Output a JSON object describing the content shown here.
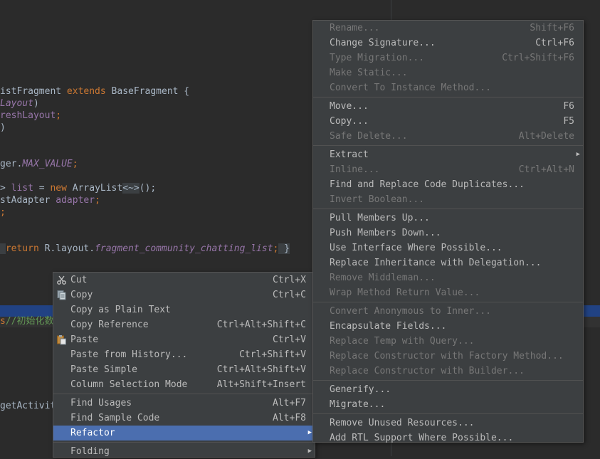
{
  "editor": {
    "lines": [
      {
        "parts": [
          {
            "t": "istFragment ",
            "c": "plain"
          },
          {
            "t": "extends ",
            "c": "kw"
          },
          {
            "t": "BaseFragment {",
            "c": "plain"
          }
        ]
      },
      {
        "parts": [
          {
            "t": "Layout",
            "c": "it"
          },
          {
            "t": ")",
            "c": "plain"
          }
        ]
      },
      {
        "parts": [
          {
            "t": "reshLayout",
            "c": "fld"
          },
          {
            "t": ";",
            "c": "kw"
          }
        ]
      },
      {
        "parts": [
          {
            "t": ")",
            "c": "plain"
          }
        ]
      },
      {
        "parts": [
          {
            "t": "ger.",
            "c": "plain"
          },
          {
            "t": "MAX_VALUE",
            "c": "it"
          },
          {
            "t": ";",
            "c": "kw"
          }
        ]
      },
      {
        "parts": [
          {
            "t": "> ",
            "c": "plain"
          },
          {
            "t": "list",
            "c": "fld"
          },
          {
            "t": " = ",
            "c": "plain"
          },
          {
            "t": "new ",
            "c": "kw"
          },
          {
            "t": "ArrayList",
            "c": "plain"
          },
          {
            "t": "<~>",
            "c": "fold"
          },
          {
            "t": "();",
            "c": "plain"
          }
        ]
      },
      {
        "parts": [
          {
            "t": "stAdapter ",
            "c": "plain"
          },
          {
            "t": "adapter",
            "c": "fld"
          },
          {
            "t": ";",
            "c": "kw"
          }
        ]
      },
      {
        "parts": [
          {
            "t": ";",
            "c": "kw"
          }
        ]
      },
      {
        "parts": [
          {
            "t": " ",
            "c": "fold"
          },
          {
            "t": "return ",
            "c": "kw"
          },
          {
            "t": "R.layout.",
            "c": "plain"
          },
          {
            "t": "fragment_community_chatting_list",
            "c": "it"
          },
          {
            "t": ";",
            "c": "kw"
          },
          {
            "t": " }",
            "c": "fold"
          }
        ]
      },
      {
        "parts": [
          {
            "t": "s",
            "c": "kw"
          },
          {
            "t": "//初始化数",
            "c": "cmt"
          }
        ]
      },
      {
        "parts": [
          {
            "t": "getActivit",
            "c": "plain"
          }
        ]
      }
    ]
  },
  "context_menu": {
    "items": [
      {
        "label": "Cut",
        "shortcut": "Ctrl+X",
        "icon": "scissors-icon",
        "disabled": false
      },
      {
        "label": "Copy",
        "shortcut": "Ctrl+C",
        "icon": "copy-icon",
        "disabled": false
      },
      {
        "label": "Copy as Plain Text",
        "shortcut": "",
        "icon": "",
        "disabled": false
      },
      {
        "label": "Copy Reference",
        "shortcut": "Ctrl+Alt+Shift+C",
        "icon": "",
        "disabled": false
      },
      {
        "label": "Paste",
        "shortcut": "Ctrl+V",
        "icon": "paste-icon",
        "disabled": false
      },
      {
        "label": "Paste from History...",
        "shortcut": "Ctrl+Shift+V",
        "icon": "",
        "disabled": false
      },
      {
        "label": "Paste Simple",
        "shortcut": "Ctrl+Alt+Shift+V",
        "icon": "",
        "disabled": false
      },
      {
        "label": "Column Selection Mode",
        "shortcut": "Alt+Shift+Insert",
        "icon": "",
        "disabled": false
      },
      {
        "sep": true
      },
      {
        "label": "Find Usages",
        "shortcut": "Alt+F7",
        "icon": "",
        "disabled": false
      },
      {
        "label": "Find Sample Code",
        "shortcut": "Alt+F8",
        "icon": "",
        "disabled": false
      },
      {
        "label": "Refactor",
        "shortcut": "",
        "icon": "",
        "disabled": false,
        "submenu": true,
        "highlighted": true
      },
      {
        "sep": true
      },
      {
        "label": "Folding",
        "shortcut": "",
        "icon": "",
        "disabled": false,
        "submenu": true
      }
    ]
  },
  "refactor_menu": {
    "items": [
      {
        "label": "Rename...",
        "shortcut": "Shift+F6",
        "disabled": true
      },
      {
        "label": "Change Signature...",
        "shortcut": "Ctrl+F6",
        "disabled": false
      },
      {
        "label": "Type Migration...",
        "shortcut": "Ctrl+Shift+F6",
        "disabled": true
      },
      {
        "label": "Make Static...",
        "shortcut": "",
        "disabled": true
      },
      {
        "label": "Convert To Instance Method...",
        "shortcut": "",
        "disabled": true
      },
      {
        "sep": true
      },
      {
        "label": "Move...",
        "shortcut": "F6",
        "disabled": false
      },
      {
        "label": "Copy...",
        "shortcut": "F5",
        "disabled": false
      },
      {
        "label": "Safe Delete...",
        "shortcut": "Alt+Delete",
        "disabled": true
      },
      {
        "sep": true
      },
      {
        "label": "Extract",
        "shortcut": "",
        "disabled": false,
        "submenu": true
      },
      {
        "label": "Inline...",
        "shortcut": "Ctrl+Alt+N",
        "disabled": true
      },
      {
        "label": "Find and Replace Code Duplicates...",
        "shortcut": "",
        "disabled": false
      },
      {
        "label": "Invert Boolean...",
        "shortcut": "",
        "disabled": true
      },
      {
        "sep": true
      },
      {
        "label": "Pull Members Up...",
        "shortcut": "",
        "disabled": false
      },
      {
        "label": "Push Members Down...",
        "shortcut": "",
        "disabled": false
      },
      {
        "label": "Use Interface Where Possible...",
        "shortcut": "",
        "disabled": false
      },
      {
        "label": "Replace Inheritance with Delegation...",
        "shortcut": "",
        "disabled": false
      },
      {
        "label": "Remove Middleman...",
        "shortcut": "",
        "disabled": true
      },
      {
        "label": "Wrap Method Return Value...",
        "shortcut": "",
        "disabled": true
      },
      {
        "sep": true
      },
      {
        "label": "Convert Anonymous to Inner...",
        "shortcut": "",
        "disabled": true
      },
      {
        "label": "Encapsulate Fields...",
        "shortcut": "",
        "disabled": false
      },
      {
        "label": "Replace Temp with Query...",
        "shortcut": "",
        "disabled": true
      },
      {
        "label": "Replace Constructor with Factory Method...",
        "shortcut": "",
        "disabled": true
      },
      {
        "label": "Replace Constructor with Builder...",
        "shortcut": "",
        "disabled": true
      },
      {
        "sep": true
      },
      {
        "label": "Generify...",
        "shortcut": "",
        "disabled": false
      },
      {
        "label": "Migrate...",
        "shortcut": "",
        "disabled": false
      },
      {
        "sep": true
      },
      {
        "label": "Remove Unused Resources...",
        "shortcut": "",
        "disabled": false
      },
      {
        "label": "Add RTL Support Where Possible...",
        "shortcut": "",
        "disabled": false
      }
    ]
  },
  "colors": {
    "highlight": "#4b6eaf",
    "menu_bg": "#3c3f41",
    "editor_bg": "#2b2b2b",
    "selection": "#214283"
  }
}
